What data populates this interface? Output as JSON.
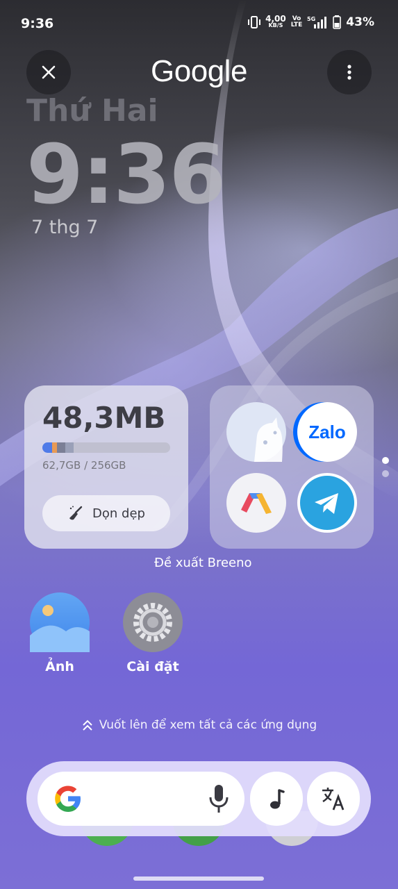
{
  "status_bar": {
    "time": "9:36",
    "net_speed_value": "4,00",
    "net_speed_unit": "KB/S",
    "volte_top": "Vo",
    "volte_bottom": "LTE",
    "network_type": "5G",
    "battery_percent": "43%"
  },
  "header": {
    "title": "Google",
    "close_icon": "close-icon",
    "more_icon": "more-vertical-icon"
  },
  "clock": {
    "day": "Thứ Hai",
    "time": "9:36",
    "date": "7 thg 7"
  },
  "storage_widget": {
    "freed": "48,3MB",
    "usage": "62,7GB / 256GB",
    "used_fraction": 0.245,
    "clean_label": "Dọn dẹp",
    "clean_icon": "broom-icon"
  },
  "suggestions": {
    "label": "Đề xuất Breeno",
    "apps": [
      {
        "name": "cat-app-icon"
      },
      {
        "name": "Zalo",
        "icon_text": "Zalo"
      },
      {
        "name": "vlc-like-app-icon"
      },
      {
        "name": "telegram-icon"
      }
    ]
  },
  "home_apps": [
    {
      "label": "Ảnh",
      "icon": "photos-icon"
    },
    {
      "label": "Cài đặt",
      "icon": "settings-gear-icon"
    }
  ],
  "swipe_hint": "Vuốt lên để xem tất cả các ứng dụng",
  "search_bar": {
    "google_icon": "google-g-icon",
    "mic_icon": "microphone-icon",
    "music_icon": "music-note-icon",
    "translate_icon": "translate-icon"
  },
  "colors": {
    "zalo_blue": "#0068ff",
    "telegram_blue": "#2aa3e0",
    "photos_blue": "#4a8ff0",
    "settings_gray": "#8d8d96"
  }
}
